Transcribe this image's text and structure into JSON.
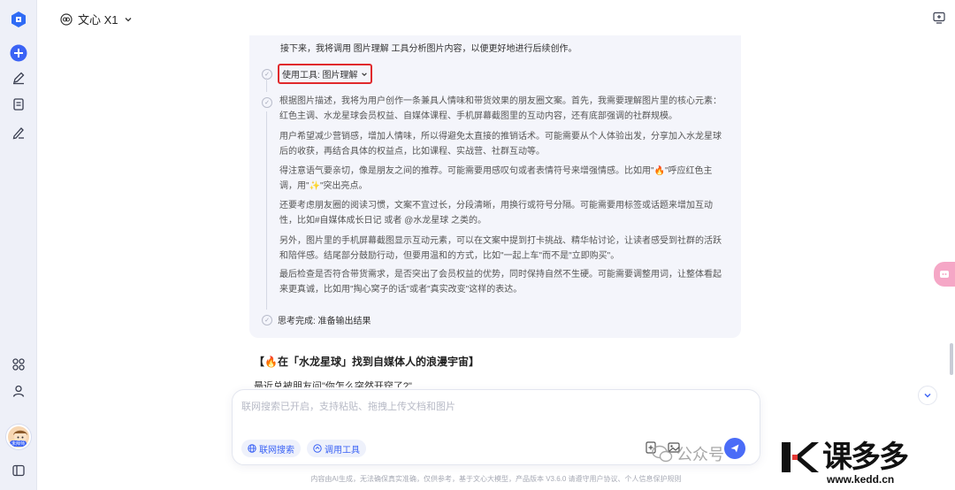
{
  "rail": {
    "icons": [
      "app-logo-icon",
      "new-chat-icon",
      "edit-icon",
      "document-icon",
      "pen-icon",
      "apps-icon",
      "user-icon",
      "sidebar-toggle-icon"
    ],
    "avatar_badge": "未拜师"
  },
  "topbar": {
    "model_name": "文心 X1"
  },
  "think": {
    "intro": "接下来，我将调用 图片理解 工具分析图片内容，以便更好地进行后续创作。",
    "tool_label": "使用工具: 图片理解",
    "paragraphs": [
      "根据图片描述，我将为用户创作一条兼具人情味和带货效果的朋友圈文案。首先，我需要理解图片里的核心元素：红色主调、水龙星球会员权益、自媒体课程、手机屏幕截图里的互动内容，还有底部强调的社群规模。",
      "用户希望减少营销感，增加人情味，所以得避免太直接的推销话术。可能需要从个人体验出发，分享加入水龙星球后的收获，再结合具体的权益点，比如课程、实战营、社群互动等。",
      "得注意语气要亲切，像是朋友之间的推荐。可能需要用感叹句或者表情符号来增强情感。比如用\"🔥\"呼应红色主调，用\"✨\"突出亮点。",
      "还要考虑朋友圈的阅读习惯，文案不宜过长，分段清晰，用换行或符号分隔。可能需要用标签或话题来增加互动性，比如#自媒体成长日记 或者 @水龙星球 之类的。",
      "另外，图片里的手机屏幕截图显示互动元素，可以在文案中提到打卡挑战、精华帖讨论，让读者感受到社群的活跃和陪伴感。结尾部分鼓励行动，但要用温和的方式，比如\"一起上车\"而不是\"立即购买\"。",
      "最后检查是否符合带货需求，是否突出了会员权益的优势，同时保持自然不生硬。可能需要调整用词，让整体看起来更真诚，比如用\"掏心窝子的话\"或者\"真实改变\"这样的表达。"
    ],
    "done_label": "思考完成: 准备输出结果"
  },
  "reply": {
    "title": "【🔥在「水龙星球」找到自媒体人的浪漫宇宙】",
    "next_line": "最近总被朋友问\"你怎么突然开窍了?\""
  },
  "input": {
    "placeholder": "联网搜索已开启，支持粘贴、拖拽上传文档和图片",
    "web_search_label": "联网搜索",
    "tool_label": "调用工具"
  },
  "footer": {
    "text": "内容由AI生成，无法确保真实准确，仅供参考，基于文心大模型，产品版本 V3.6.0 请遵守用户协议、个人信息保护规则"
  },
  "watermark": {
    "gzh": "公众号",
    "brand": "课多多",
    "url": "www.kedd.cn"
  },
  "colors": {
    "accent": "#3b63f5",
    "highlight_border": "#e0292c",
    "think_bg": "#f4f5fb"
  }
}
